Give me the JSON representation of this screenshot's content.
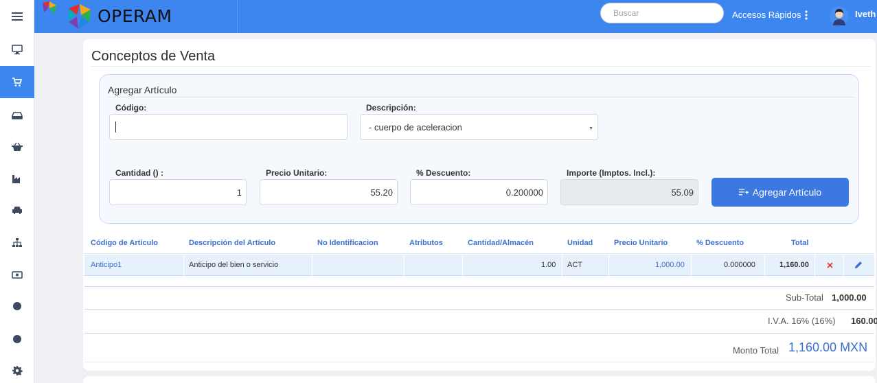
{
  "app": {
    "brand": "OPERAM"
  },
  "header": {
    "search_placeholder": "Buscar",
    "quick_access": "Accesos Rápidos",
    "user": "Iveth"
  },
  "sidebar": {
    "items": [
      {
        "icon": "menu-icon"
      },
      {
        "icon": "monitor-icon"
      },
      {
        "icon": "cart-icon",
        "active": true
      },
      {
        "icon": "inbox-icon"
      },
      {
        "icon": "basket-icon"
      },
      {
        "icon": "factory-icon"
      },
      {
        "icon": "car-icon"
      },
      {
        "icon": "sitemap-icon"
      },
      {
        "icon": "money-icon"
      },
      {
        "icon": "circle-icon"
      },
      {
        "icon": "circle-icon"
      },
      {
        "icon": "gear-icon"
      }
    ]
  },
  "page": {
    "title": "Conceptos de Venta"
  },
  "add_item": {
    "title": "Agregar Artículo",
    "code_label": "Código:",
    "code_value": "",
    "description_label": "Descripción:",
    "description_value": "- cuerpo de aceleracion",
    "quantity_label": "Cantidad () :",
    "quantity_value": "1",
    "unit_price_label": "Precio Unitario:",
    "unit_price_value": "55.20",
    "discount_label": "% Descuento:",
    "discount_value": "0.200000",
    "amount_label": "Importe (Imptos. Incl.):",
    "amount_value": "55.09",
    "add_button": "Agregar Artículo"
  },
  "table": {
    "headers": [
      "Código de Artículo",
      "Descripción del Artículo",
      "No Identificacion",
      "Atributos",
      "Cantidad/Almacén",
      "Unidad",
      "Precio Unitario",
      "% Descuento",
      "Total"
    ],
    "rows": [
      {
        "code": "Anticipo1",
        "description": "Anticipo del bien o servicio",
        "id_no": "",
        "attributes": "",
        "quantity": "1.00",
        "unit": "ACT",
        "unit_price": "1,000.00",
        "discount": "0.000000",
        "total": "1,160.00"
      }
    ]
  },
  "summary": {
    "subtotal_label": "Sub-Total",
    "subtotal_value": "1,000.00",
    "iva_label": "I.V.A. 16% (16%)",
    "iva_value": "160.00",
    "total_label": "Monto Total",
    "total_value": "1,160.00 MXN"
  },
  "colors": {
    "primary": "#3d86f0",
    "button": "#3d78e0",
    "link": "#3a6fd0",
    "delete": "#e53935"
  }
}
